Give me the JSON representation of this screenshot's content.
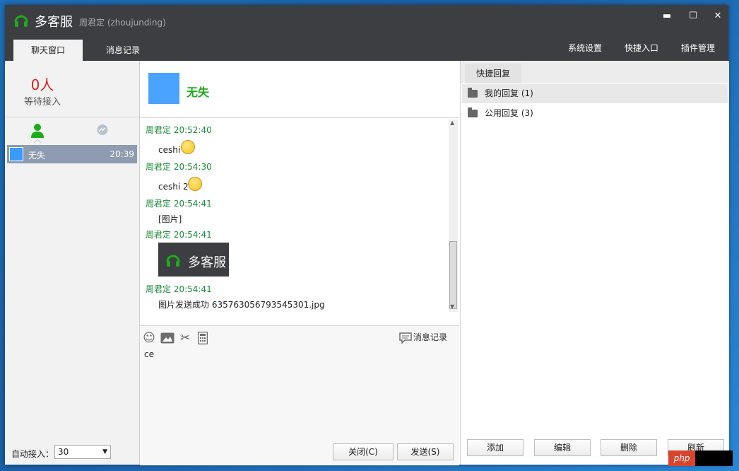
{
  "titlebar": {
    "app_name": "多客服",
    "user": "周君定 (zhoujunding)",
    "buttons": {
      "minimize": "▬",
      "maximize": "☐",
      "close": "✕"
    }
  },
  "tabs": [
    {
      "label": "聊天窗口",
      "active": true
    },
    {
      "label": "消息记录",
      "active": false
    }
  ],
  "top_menu": [
    "系统设置",
    "快捷入口",
    "插件管理"
  ],
  "left": {
    "waiting_count": "0人",
    "waiting_label": "等待接入",
    "session": {
      "name": "无失",
      "time": "20:39"
    },
    "auto_accept_label": "自动接入：",
    "auto_accept_value": "30"
  },
  "chat": {
    "contact_name": "无失",
    "messages": [
      {
        "meta": "周君定  20:52:40",
        "text": "ceshi",
        "emoji": true
      },
      {
        "meta": "周君定  20:54:30",
        "text": "ceshi 2",
        "emoji": true
      },
      {
        "meta": "周君定  20:54:41",
        "text": "[图片]"
      },
      {
        "meta": "周君定  20:54:41",
        "image_caption": "多客服"
      },
      {
        "meta": "周君定  20:54:41",
        "text": "图片发送成功 635763056793545301.jpg"
      }
    ],
    "history_label": "消息记录",
    "input_value": "ce",
    "close_label": "关闭(C)",
    "send_label": "发送(S)"
  },
  "quick_reply": {
    "tab_label": "快捷回复",
    "groups": [
      "我的回复 (1)",
      "公用回复 (3)"
    ],
    "buttons": {
      "add": "添加",
      "edit": "编辑",
      "delete": "删除",
      "refresh": "刷新"
    }
  },
  "watermark": "php",
  "colors": {
    "titlebar": "#3d3e42",
    "accent_green": "#1aad19",
    "alert_red": "#e02020",
    "selection": "#8e9bb0"
  }
}
